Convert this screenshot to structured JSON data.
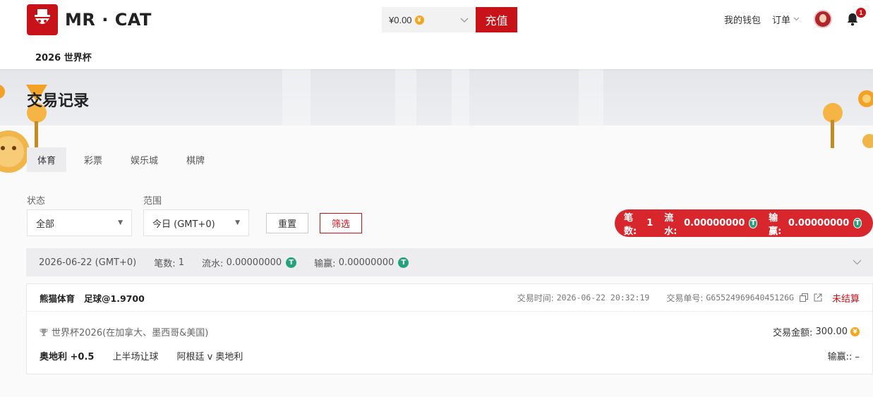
{
  "header": {
    "brand": "MR · CAT",
    "balance": "¥0.00",
    "recharge_label": "充值",
    "wallet_label": "我的钱包",
    "orders_label": "订单",
    "notification_count": "1",
    "subnav_item": "2026 世界杯",
    "brand_color": "#c8121a"
  },
  "page": {
    "title": "交易记录"
  },
  "tabs": [
    {
      "label": "体育",
      "active": true
    },
    {
      "label": "彩票",
      "active": false
    },
    {
      "label": "娱乐城",
      "active": false
    },
    {
      "label": "棋牌",
      "active": false
    }
  ],
  "filters": {
    "status_label": "状态",
    "status_value": "全部",
    "range_label": "范围",
    "range_value": "今日 (GMT+0)",
    "reset_label": "重置",
    "filter_label": "筛选"
  },
  "summary": {
    "count_label": "笔数:",
    "count_value": "1",
    "turnover_label": "流水:",
    "turnover_value": "0.00000000",
    "winloss_label": "输赢:",
    "winloss_value": "0.00000000"
  },
  "date_group": {
    "date": "2026-06-22 (GMT+0)",
    "count_label": "笔数:",
    "count_value": "1",
    "turnover_label": "流水:",
    "turnover_value": "0.00000000",
    "winloss_label": "输赢:",
    "winloss_value": "0.00000000"
  },
  "record": {
    "title": "熊猫体育   足球@1.9700",
    "time_label": "交易时间:",
    "time_value": "2026-06-22 20:32:19",
    "order_label": "交易单号:",
    "order_value": "G6552496964045126G",
    "status": "未结算",
    "league": "世界杯2026(在加拿大、墨西哥&美国)",
    "amount_label": "交易金额:",
    "amount_value": "300.00",
    "selection": "奥地利 +0.5",
    "market": "上半场让球",
    "match": "阿根廷 v 奥地利",
    "winloss_text": "输赢:: –"
  }
}
